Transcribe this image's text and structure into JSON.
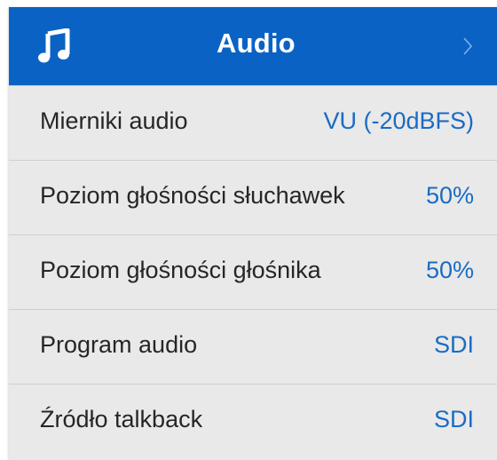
{
  "header": {
    "title": "Audio",
    "icon": "music-note-icon",
    "chevron_icon": "chevron-right-icon",
    "background_color": "#0a63c4"
  },
  "settings": [
    {
      "label": "Mierniki audio",
      "value": "VU (-20dBFS)"
    },
    {
      "label": "Poziom głośności słuchawek",
      "value": "50%"
    },
    {
      "label": "Poziom głośności głośnika",
      "value": "50%"
    },
    {
      "label": "Program audio",
      "value": "SDI"
    },
    {
      "label": "Źródło talkback",
      "value": "SDI"
    }
  ],
  "colors": {
    "accent": "#1a6cc3",
    "row_background": "#e9e9e9",
    "divider": "#cfcfcf"
  }
}
